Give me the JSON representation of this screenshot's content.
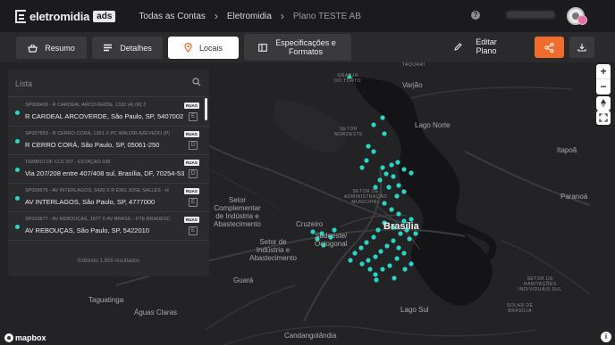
{
  "header": {
    "logo_text": "eletromidia",
    "logo_badge": "ads",
    "breadcrumbs": [
      "Todas as Contas",
      "Eletromidia",
      "Plano TESTE AB"
    ],
    "help_icon": "question-circle-icon",
    "user_name": "",
    "avatar_badge_color": "#e46ea6"
  },
  "tabs": [
    {
      "label": "Resumo",
      "icon": "basket-icon"
    },
    {
      "label": "Detalhes",
      "icon": "list-icon"
    },
    {
      "label": "Locais",
      "icon": "map-pin-icon",
      "active": true
    },
    {
      "label": "Especificações e Formatos",
      "icon": "layout-icon"
    }
  ],
  "actions": {
    "edit_label": "Editar Plano",
    "share_icon": "share-icon",
    "download_icon": "download-icon",
    "accent": "#f26c2d"
  },
  "list": {
    "placeholder": "Lista",
    "items": [
      {
        "code": "SP008400 - R CARDEAL ARCOVERDE, 1332 (4) (R) 2",
        "address": "R CARDEAL ARCOVERDE, São Paulo, SP, 5407002",
        "tag": "RUAS",
        "mini": "E"
      },
      {
        "code": "SP007853 - R CERRO CORÁ, 1261 X PC WALDIR AZEVEDO (P)",
        "address": "R CERRO CORÁ, São Paulo, SP, 05061-250",
        "tag": "RUAS",
        "mini": "D"
      },
      {
        "code": "TEMBICI DF CLS 207 - ESTAÇÃO 035",
        "address": "Via 207/208 entre 407/408 sul, Brasília, DF, 70254-530",
        "tag": "RUAS",
        "mini": "D"
      },
      {
        "code": "SP009675 - AV INTERLAGOS, 5420 X R ENG JOSÉ SALLES - H",
        "address": "AV INTERLAGOS, São Paulo, SP, 4777000",
        "tag": "RUAS",
        "mini": "E"
      },
      {
        "code": "SP015877 - AV REBOUÇAS, 1877 X AV BRASIL - FTE BRADESC",
        "address": "AV REBOUÇAS, São Paulo, SP, 5422010",
        "tag": "RUAS",
        "mini": "E"
      }
    ],
    "footer": "Exibindo 1.856 resultados",
    "dot_color": "#27d6c4"
  },
  "map": {
    "labels": {
      "varjao": "Varjão",
      "granja": "GRANJA\nDO TORTO",
      "taquari": "TAQUARI",
      "lago_norte": "Lago Norte",
      "setor_noroeste": "SETOR\nNOROESTE",
      "itapoa": "Itapoã",
      "parangua": "Paranoá",
      "setor_admin": "SETOR DE\nADMINISTRAÇÃO\nMUNICIPAL",
      "setor_complementar": "Setor\nComplementar\nde Indústria e\nAbastecimento",
      "setor_industria": "Setor de\nIndústria e\nAbastecimento",
      "cruzeiro": "Cruzeiro",
      "sudoeste": "Sudoeste/\nOctogonal",
      "brasilia": "Brasília",
      "guara": "Guará",
      "lago_sul": "Lago Sul",
      "taguatinga": "Taguatinga",
      "aguas_claras": "Águas Claras",
      "candangolandia": "Candangolândia",
      "solar": "SOLAR DE\nBRASÍLIA",
      "setor_sol": "SETOR DE\nHABITAÇÕES\nINDIVIDUAIS SUL"
    },
    "attribution": "mapbox",
    "zoom_in": "+",
    "zoom_out": "−",
    "compass_icon": "compass-icon",
    "fullscreen_icon": "fullscreen-icon",
    "info_icon": "info-icon",
    "marker_color": "#27d6c4"
  }
}
